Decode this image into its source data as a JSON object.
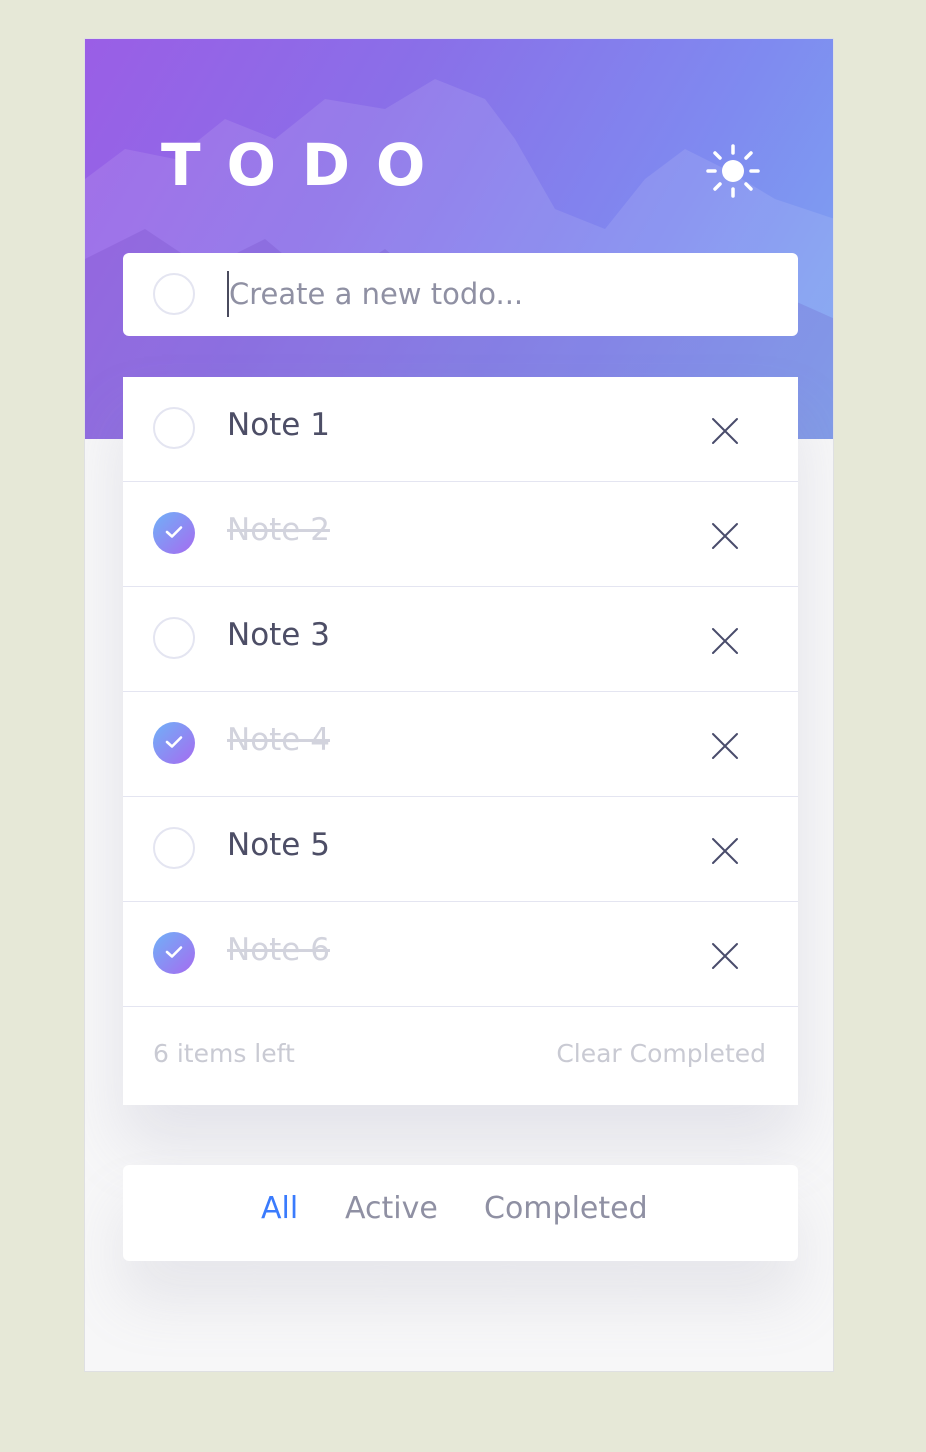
{
  "header": {
    "title": "TODO",
    "theme_icon": "sun-icon"
  },
  "new_todo": {
    "placeholder": "Create a new todo..."
  },
  "todos": [
    {
      "label": "Note 1",
      "completed": false
    },
    {
      "label": "Note 2",
      "completed": true
    },
    {
      "label": "Note 3",
      "completed": false
    },
    {
      "label": "Note 4",
      "completed": true
    },
    {
      "label": "Note 5",
      "completed": false
    },
    {
      "label": "Note 6",
      "completed": true
    }
  ],
  "footer": {
    "items_left": "6 items left",
    "clear_label": "Clear Completed"
  },
  "filters": {
    "all": "All",
    "active": "Active",
    "completed": "Completed",
    "selected": "All"
  },
  "colors": {
    "accent": "#3a7bfd",
    "check_gradient_start": "#6fb1f7",
    "check_gradient_end": "#a66bf0"
  }
}
